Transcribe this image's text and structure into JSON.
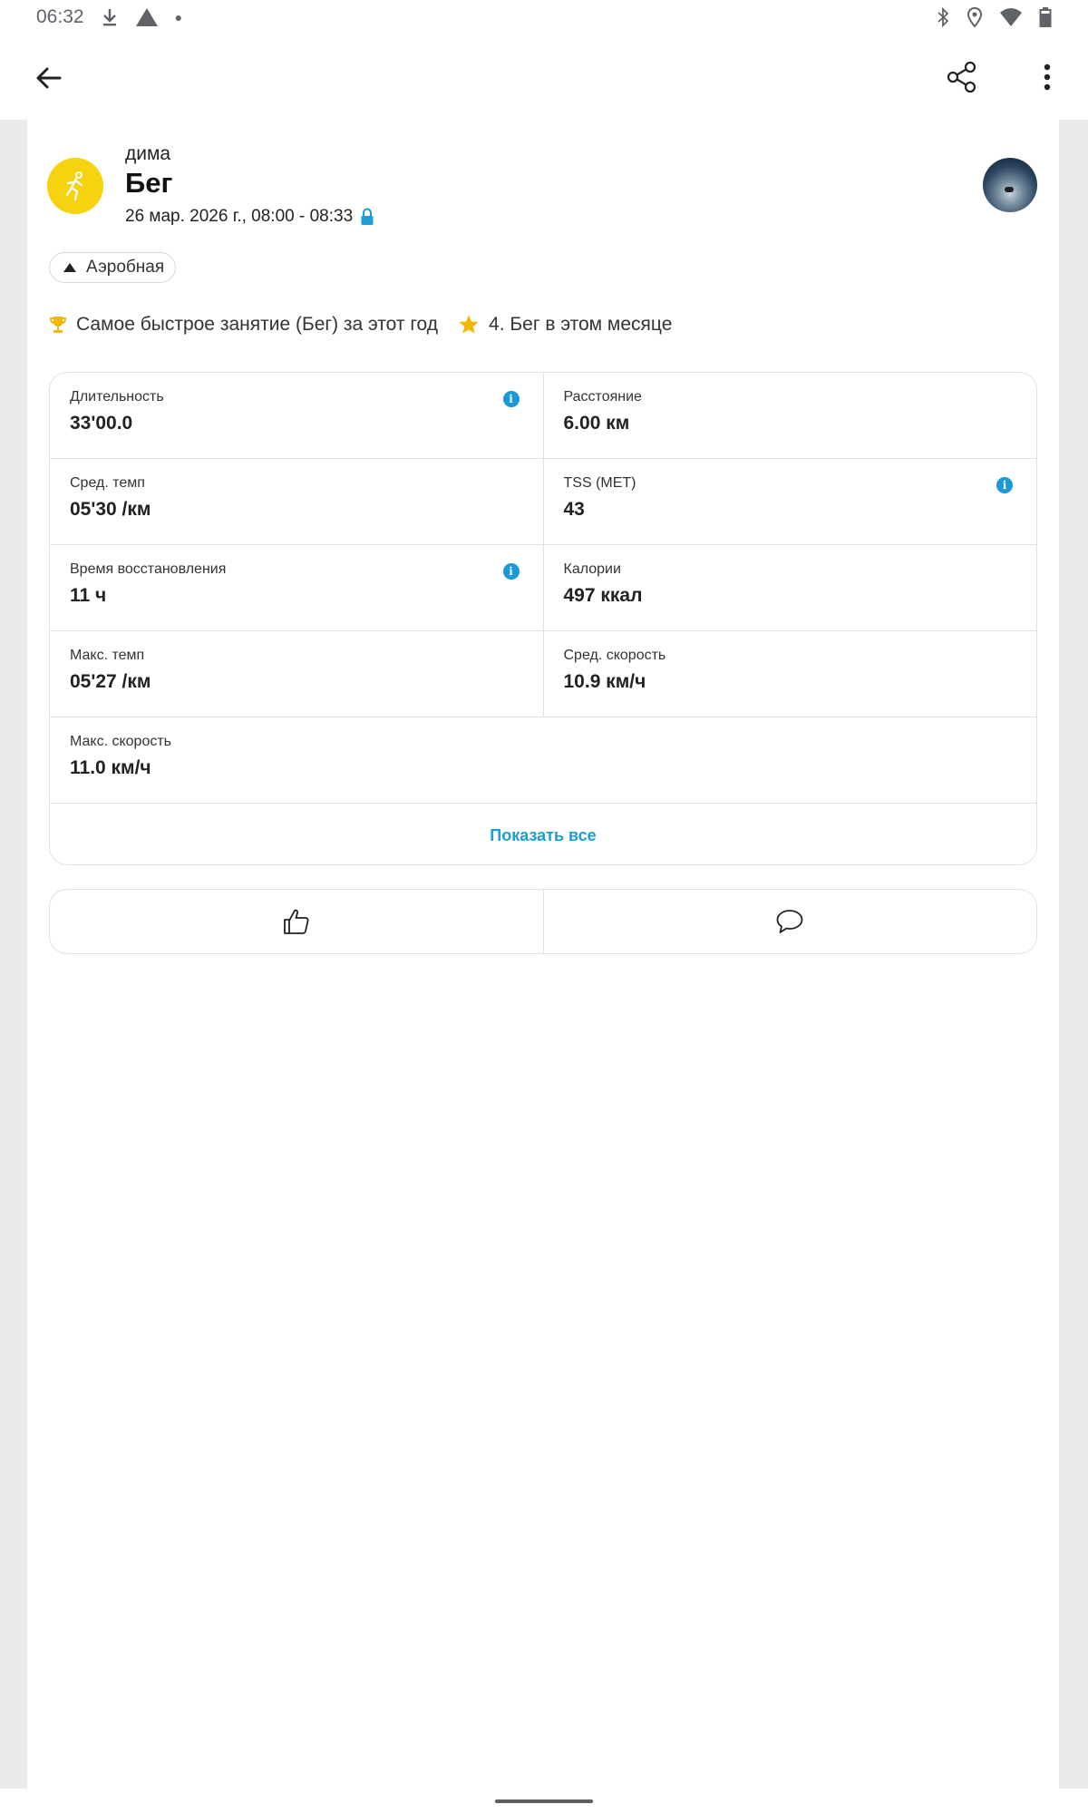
{
  "status_bar": {
    "time": "06:32"
  },
  "activity": {
    "user_name": "дима",
    "title": "Бег",
    "date": "26 мар. 2026 г., 08:00 - 08:33",
    "intensity": "Аэробная"
  },
  "achievements": {
    "first": "Самое быстрое занятие (Бег) за этот год",
    "second": "4. Бег в этом месяце"
  },
  "stats": [
    {
      "label": "Длительность",
      "value": "33'00.0"
    },
    {
      "label": "Расстояние",
      "value": "6.00 км"
    },
    {
      "label": "Сред. темп",
      "value": "05'30 /км"
    },
    {
      "label": "TSS (MET)",
      "value": "43"
    },
    {
      "label": "Время восстановления",
      "value": "11 ч"
    },
    {
      "label": "Калории",
      "value": "497 ккал"
    },
    {
      "label": "Макс. темп",
      "value": "05'27 /км"
    },
    {
      "label": "Сред. скорость",
      "value": "10.9 км/ч"
    },
    {
      "label": "Макс. скорость",
      "value": "11.0 км/ч"
    }
  ],
  "show_all_label": "Показать все",
  "colors": {
    "accent": "#1a9fd6",
    "activity_icon": "#f6d20f",
    "info": "#1a98d8"
  }
}
